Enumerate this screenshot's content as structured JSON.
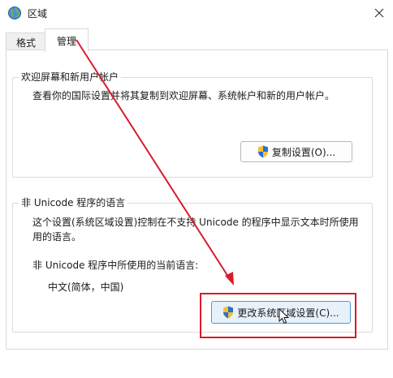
{
  "window": {
    "title": "区域"
  },
  "tabs": [
    {
      "label": "格式",
      "selected": false
    },
    {
      "label": "管理",
      "selected": true
    }
  ],
  "welcome_group": {
    "title": "欢迎屏幕和新用户帐户",
    "description": "查看你的国际设置并将其复制到欢迎屏幕、系统帐户和新的用户帐户。",
    "copy_button": "复制设置(O)..."
  },
  "unicode_group": {
    "title": "非 Unicode 程序的语言",
    "description_line1": "这个设置(系统区域设置)控制在不支持 Unicode 的程序中显示文本时所使用",
    "description_line2": "用的语言。",
    "current_label": "非 Unicode 程序中所使用的当前语言:",
    "current_value": "中文(简体，中国)",
    "change_button": "更改系统区域设置(C)..."
  },
  "colors": {
    "annotation_red": "#d81c2b",
    "shield_blue": "#2b6fd6",
    "shield_yellow": "#f3c12b"
  },
  "icons": {
    "app": "globe-icon",
    "close": "close-icon",
    "uac": "uac-shield-icon",
    "cursor": "mouse-pointer-icon"
  }
}
